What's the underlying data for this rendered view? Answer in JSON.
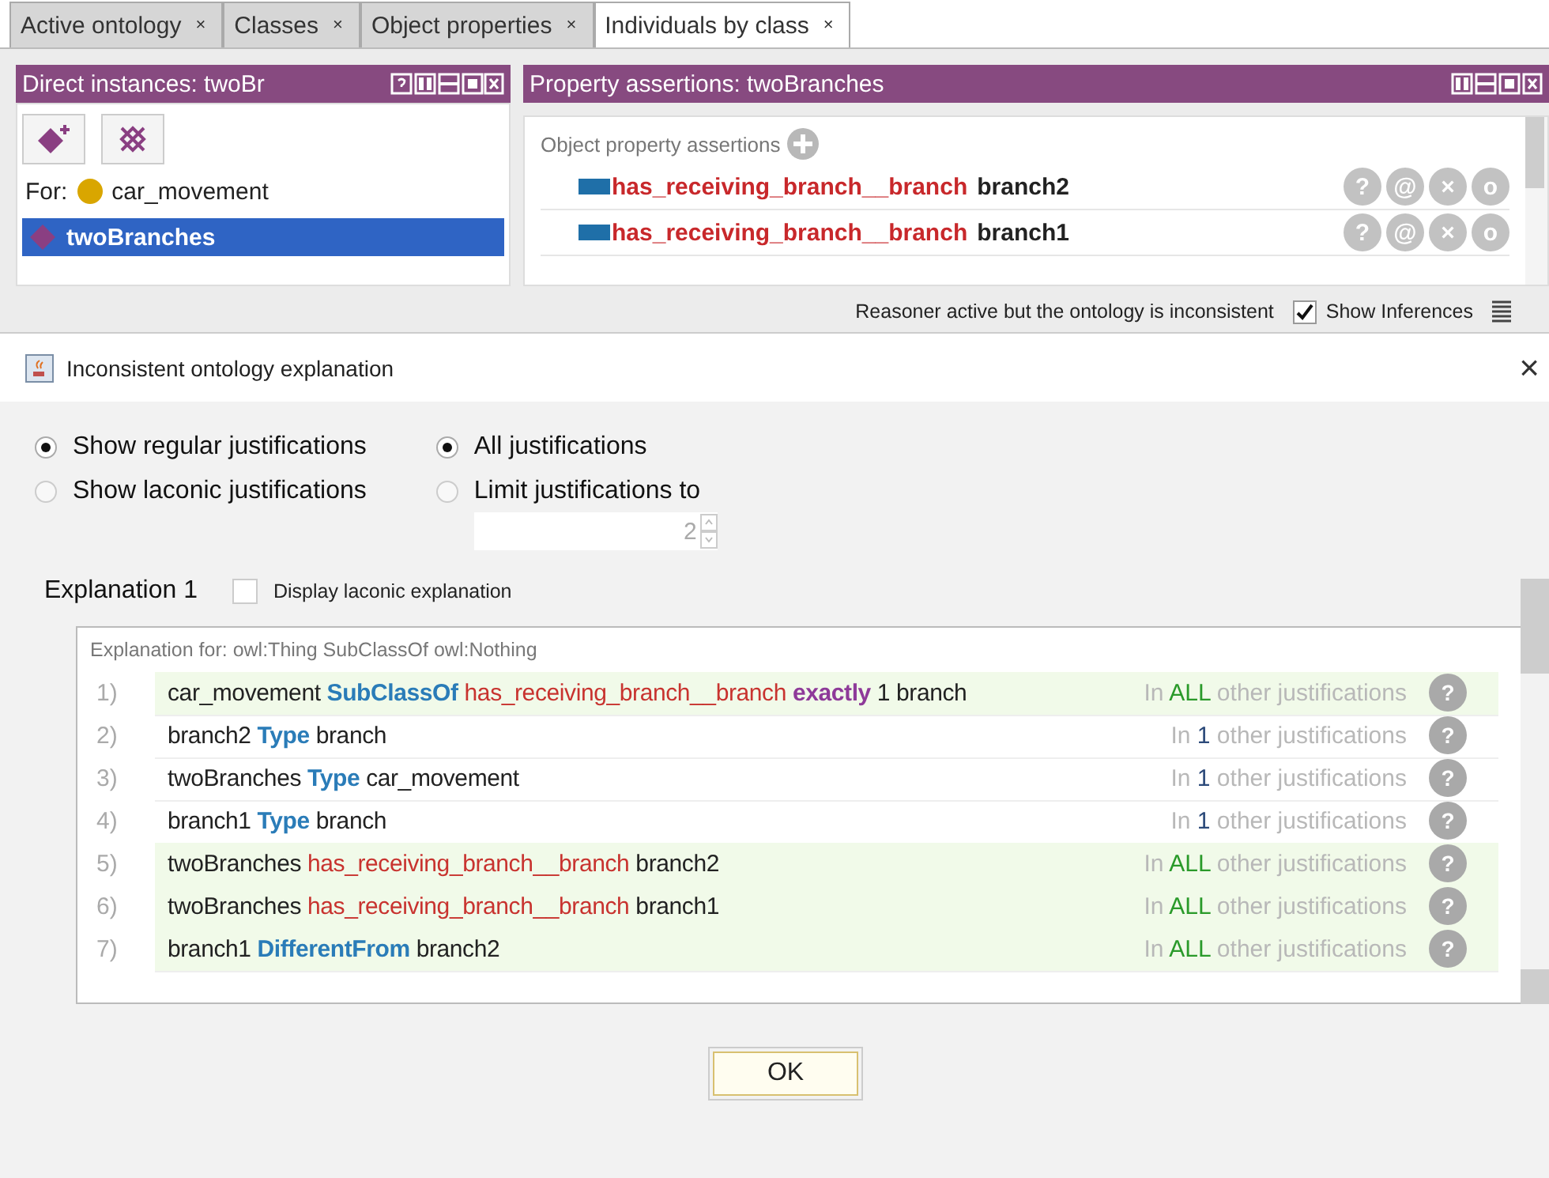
{
  "tabs": [
    {
      "label": "Active ontology",
      "close": "×",
      "selected": false
    },
    {
      "label": "Classes",
      "close": "×",
      "selected": false
    },
    {
      "label": "Object properties",
      "close": "×",
      "selected": false
    },
    {
      "label": "Individuals by class",
      "close": "×",
      "selected": true
    }
  ],
  "instances_panel": {
    "title": "Direct instances: twoBr",
    "for_label": "For:",
    "for_class": "car_movement",
    "items": [
      {
        "label": "twoBranches",
        "selected": true
      }
    ]
  },
  "assertions_panel": {
    "title": "Property assertions: twoBranches",
    "section": "Object property assertions",
    "rows": [
      {
        "property": "has_receiving_branch__branch",
        "value": "branch2",
        "buttons": [
          "?",
          "@",
          "×",
          "o"
        ]
      },
      {
        "property": "has_receiving_branch__branch",
        "value": "branch1",
        "buttons": [
          "?",
          "@",
          "×",
          "o"
        ]
      }
    ]
  },
  "status_bar": {
    "message": "Reasoner active but the ontology is inconsistent",
    "show_inferences": {
      "label": "Show Inferences",
      "checked": true
    }
  },
  "dialog": {
    "title": "Inconsistent ontology explanation",
    "close": "×",
    "mode_options": [
      {
        "label": "Show regular justifications",
        "selected": true
      },
      {
        "label": "Show laconic justifications",
        "selected": false
      }
    ],
    "count_options": [
      {
        "label": "All justifications",
        "selected": true
      },
      {
        "label": "Limit justifications to",
        "selected": false
      }
    ],
    "limit_value": "2",
    "limit_disabled": true,
    "explanation_title": "Explanation 1",
    "laconic_checkbox": {
      "label": "Display laconic explanation",
      "checked": false
    },
    "explanation_for": "Explanation for: owl:Thing SubClassOf owl:Nothing",
    "axioms": [
      {
        "number": "1)",
        "highlighted": true,
        "parts": [
          {
            "kind": "entity",
            "text": "car_movement"
          },
          {
            "kind": "keyword",
            "text": "SubClassOf"
          },
          {
            "kind": "property",
            "text": "has_receiving_branch__branch"
          },
          {
            "kind": "restriction",
            "text": "exactly"
          },
          {
            "kind": "entity",
            "text": "1 branch"
          }
        ],
        "usage": {
          "prefix": "In",
          "count": {
            "text": "ALL",
            "color": "#2a9a2a"
          },
          "suffix": "other justifications"
        },
        "help": "?"
      },
      {
        "number": "2)",
        "highlighted": false,
        "parts": [
          {
            "kind": "entity",
            "text": "branch2"
          },
          {
            "kind": "keyword",
            "text": "Type"
          },
          {
            "kind": "entity",
            "text": "branch"
          }
        ],
        "usage": {
          "prefix": "In",
          "count": {
            "text": "1",
            "color": "#2c4a7a"
          },
          "suffix": "other justifications"
        },
        "help": "?"
      },
      {
        "number": "3)",
        "highlighted": false,
        "parts": [
          {
            "kind": "entity",
            "text": "twoBranches"
          },
          {
            "kind": "keyword",
            "text": "Type"
          },
          {
            "kind": "entity",
            "text": "car_movement"
          }
        ],
        "usage": {
          "prefix": "In",
          "count": {
            "text": "1",
            "color": "#2c4a7a"
          },
          "suffix": "other justifications"
        },
        "help": "?"
      },
      {
        "number": "4)",
        "highlighted": false,
        "parts": [
          {
            "kind": "entity",
            "text": "branch1"
          },
          {
            "kind": "keyword",
            "text": "Type"
          },
          {
            "kind": "entity",
            "text": "branch"
          }
        ],
        "usage": {
          "prefix": "In",
          "count": {
            "text": "1",
            "color": "#2c4a7a"
          },
          "suffix": "other justifications"
        },
        "help": "?"
      },
      {
        "number": "5)",
        "highlighted": true,
        "parts": [
          {
            "kind": "entity",
            "text": "twoBranches"
          },
          {
            "kind": "property",
            "text": "has_receiving_branch__branch"
          },
          {
            "kind": "entity",
            "text": "branch2"
          }
        ],
        "usage": {
          "prefix": "In",
          "count": {
            "text": "ALL",
            "color": "#2a9a2a"
          },
          "suffix": "other justifications"
        },
        "help": "?"
      },
      {
        "number": "6)",
        "highlighted": true,
        "parts": [
          {
            "kind": "entity",
            "text": "twoBranches"
          },
          {
            "kind": "property",
            "text": "has_receiving_branch__branch"
          },
          {
            "kind": "entity",
            "text": "branch1"
          }
        ],
        "usage": {
          "prefix": "In",
          "count": {
            "text": "ALL",
            "color": "#2a9a2a"
          },
          "suffix": "other justifications"
        },
        "help": "?"
      },
      {
        "number": "7)",
        "highlighted": true,
        "parts": [
          {
            "kind": "entity",
            "text": "branch1"
          },
          {
            "kind": "keyword",
            "text": "DifferentFrom"
          },
          {
            "kind": "entity",
            "text": "branch2"
          }
        ],
        "usage": {
          "prefix": "In",
          "count": {
            "text": "ALL",
            "color": "#2a9a2a"
          },
          "suffix": "other justifications"
        },
        "help": "?"
      }
    ],
    "ok_button": "OK"
  }
}
